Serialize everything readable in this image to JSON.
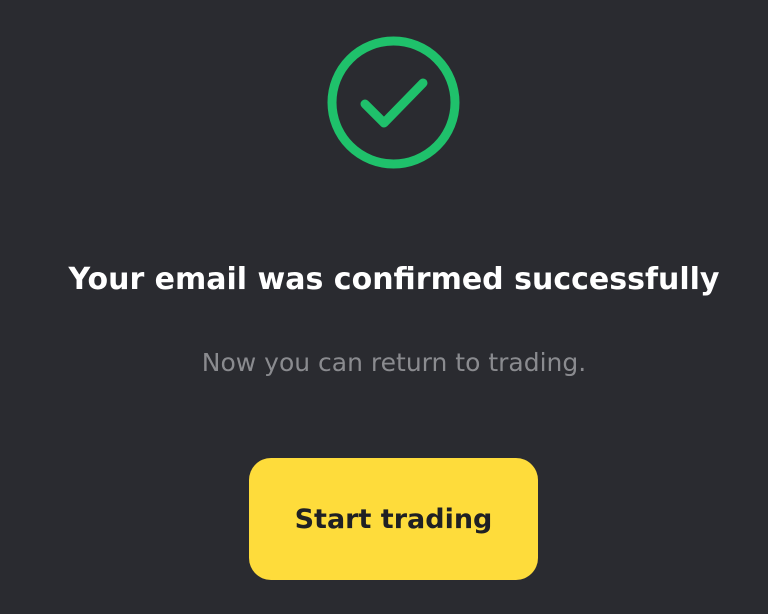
{
  "status": {
    "icon": "check-circle-icon",
    "icon_color": "#1fc16b"
  },
  "message": {
    "title": "Your email was confirmed successfully",
    "subtitle": "Now you can return to trading."
  },
  "actions": {
    "start_label": "Start trading",
    "button_color": "#fedc3b"
  },
  "theme": {
    "background": "#2a2b30"
  }
}
